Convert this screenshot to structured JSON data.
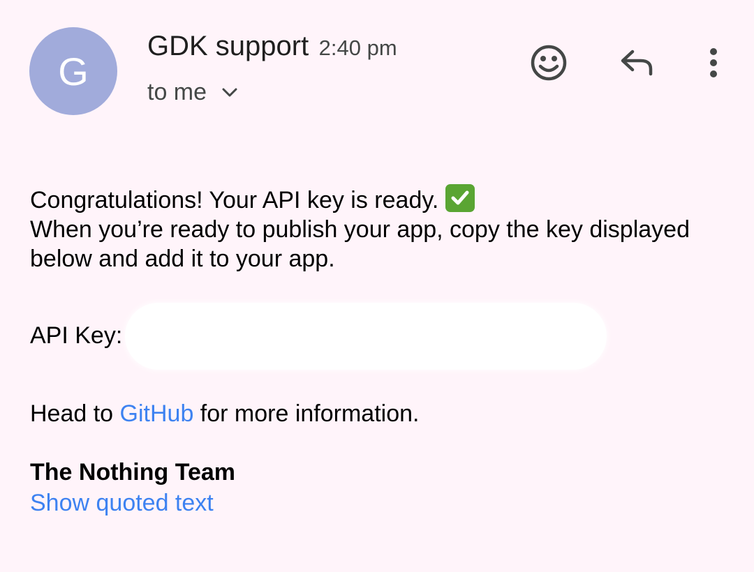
{
  "sender": {
    "initial": "G",
    "name": "GDK support",
    "time": "2:40 pm",
    "recipient": "to me"
  },
  "actions": {
    "emoji_icon": "smiley-icon",
    "reply_icon": "reply-icon",
    "more_icon": "more-vert-icon"
  },
  "message": {
    "line1": "Congratulations! Your API key is ready.",
    "line2": "When you’re ready to publish your app, copy the key displayed below and add it to your app.",
    "api_key_label": "API Key:",
    "head_prefix": "Head to ",
    "github_link": "GitHub",
    "head_suffix": " for more information.",
    "signature": "The Nothing Team"
  },
  "footer": {
    "show_quoted": "Show quoted text"
  },
  "colors": {
    "background": "#fff4fa",
    "avatar": "#a1abdb",
    "link": "#3d82f1",
    "check": "#5aa533"
  }
}
